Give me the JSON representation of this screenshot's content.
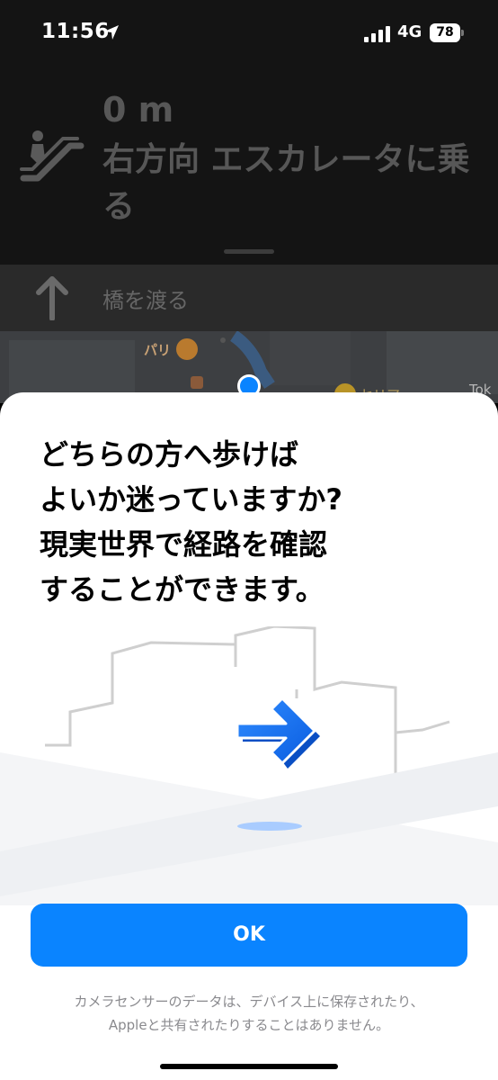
{
  "status_bar": {
    "time": "11:56",
    "network": "4G",
    "battery": "78",
    "battery_level": 0.78
  },
  "navigation": {
    "distance": "0 m",
    "instruction": "右方向 エスカレータに乗る",
    "icon": "escalator-icon",
    "next_step": {
      "icon": "arrow-up-icon",
      "label": "橋を渡る"
    }
  },
  "map": {
    "poi_1": "パリ",
    "poi_2": "セリア",
    "corner_label": "Tok"
  },
  "sheet": {
    "headline": "どちらの方へ歩けばよいか迷っていますか? 現実世界で経路を確認することができます。",
    "headline_lines": [
      "どちらの方へ歩けば",
      "よいか迷っていますか?",
      "現実世界で経路を確認",
      "することができます。"
    ],
    "ok_label": "OK",
    "disclaimer_lines": [
      "カメラセンサーのデータは、デバイス上に保存されたり、",
      "Appleと共有されたりすることはありません。"
    ],
    "accent_color": "#0a84ff"
  }
}
